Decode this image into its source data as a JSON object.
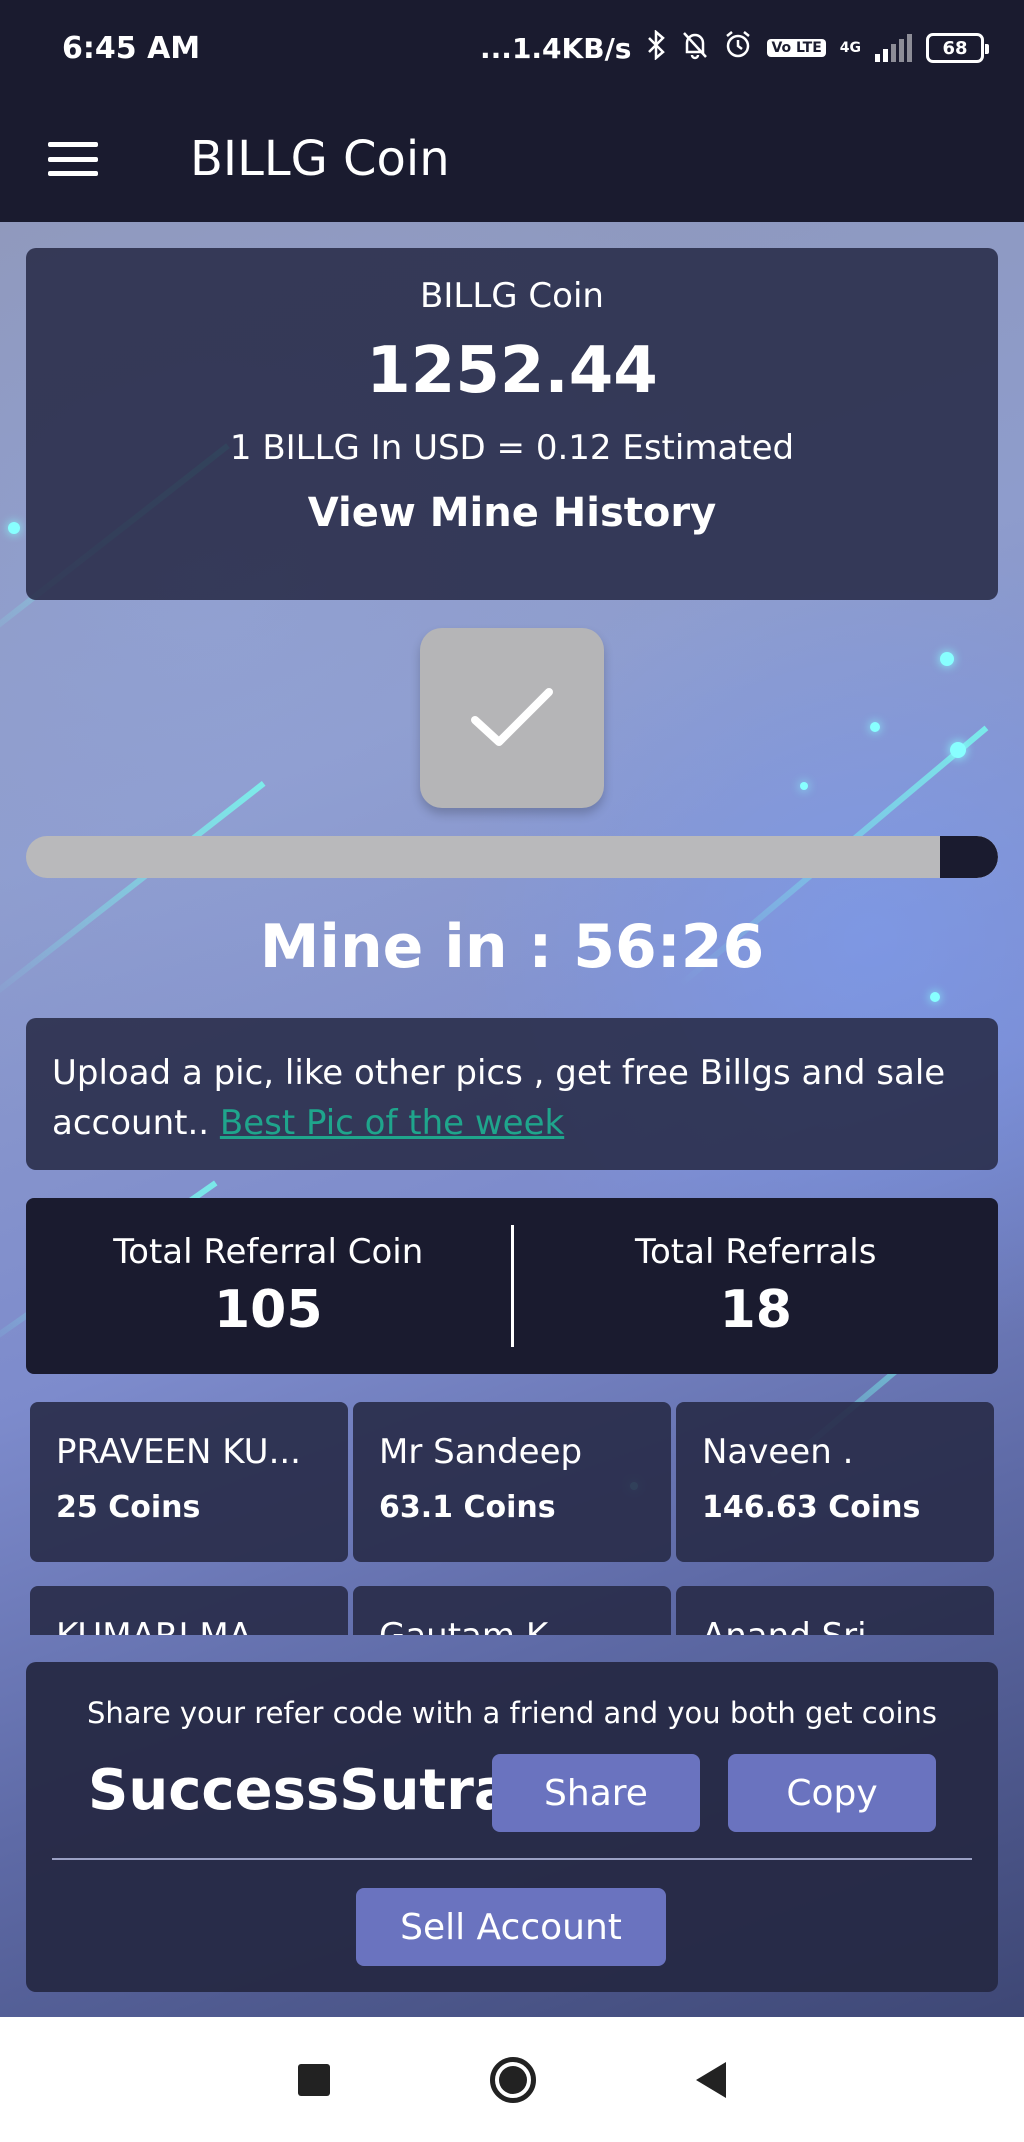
{
  "status_bar": {
    "time": "6:45 AM",
    "network_speed": "...1.4KB/s",
    "lte_badge": "Vo LTE",
    "network_type": "4G",
    "battery": "68",
    "icons": [
      "bluetooth-icon",
      "bell-off-icon",
      "alarm-icon",
      "signal-icon",
      "battery-icon"
    ]
  },
  "app_bar": {
    "title": "BILLG Coin",
    "menu_icon": "hamburger-menu-icon"
  },
  "balance": {
    "label": "BILLG Coin",
    "value": "1252.44",
    "usd_rate": "1 BILLG In USD = 0.12 Estimated",
    "history_link": "View Mine History"
  },
  "mining": {
    "button_icon": "checkmark-icon",
    "progress_fraction": 0.06,
    "timer": "Mine in : 56:26"
  },
  "promo": {
    "text": "Upload a pic, like other pics , get free Billgs and sale account.. ",
    "link": "Best Pic of the week "
  },
  "referral_stats": {
    "coin_label": "Total Referral Coin",
    "coin_value": "105",
    "count_label": "Total Referrals",
    "count_value": "18"
  },
  "referrals": [
    {
      "name": "PRAVEEN KU...",
      "coins": "25 Coins"
    },
    {
      "name": "Mr Sandeep",
      "coins": "63.1 Coins"
    },
    {
      "name": "Naveen .",
      "coins": "146.63 Coins"
    },
    {
      "name": "KUMARI MA...",
      "coins": ""
    },
    {
      "name": "Gautam K...",
      "coins": ""
    },
    {
      "name": "Anand Sri...",
      "coins": ""
    }
  ],
  "refer": {
    "message": "Share your refer code with a friend and you both get coins",
    "code": "SuccessSutra",
    "share_label": "Share",
    "copy_label": "Copy",
    "sell_label": "Sell Account"
  },
  "nav_bar": {
    "icons": [
      "recent-apps-icon",
      "home-icon",
      "back-icon"
    ]
  },
  "colors": {
    "primary_dark": "#1a1b2f",
    "button_blue": "#6a73bf",
    "link_green": "#1fa58c",
    "mine_button_grey": "#b5b5b7"
  }
}
